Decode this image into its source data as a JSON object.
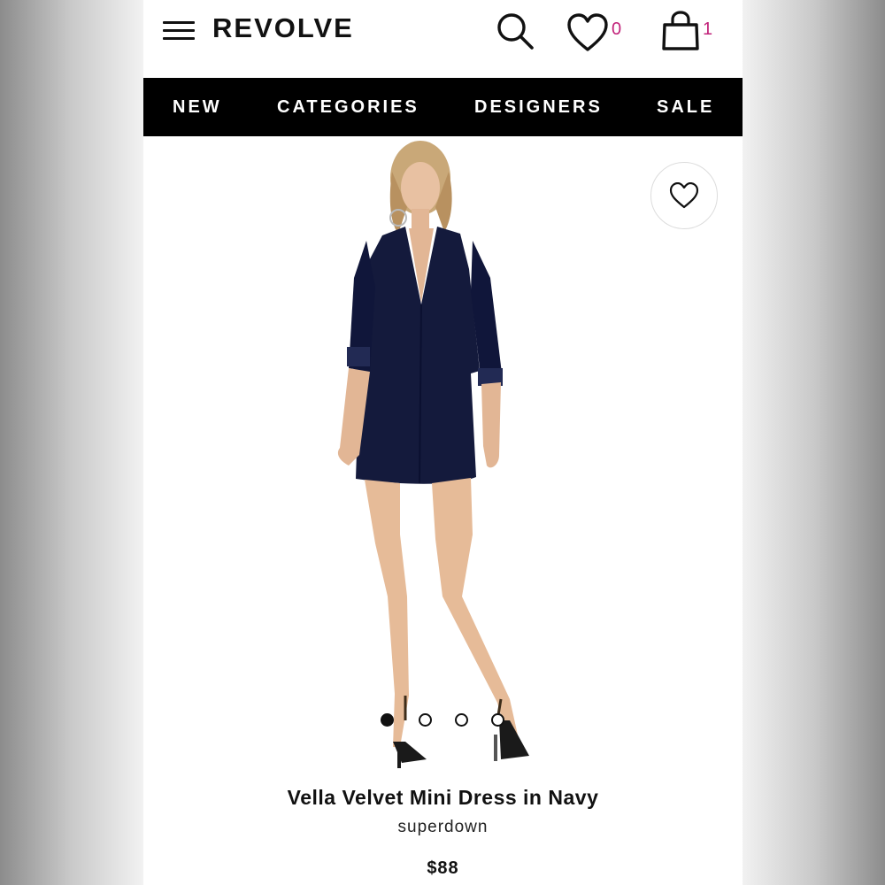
{
  "header": {
    "logo": "REVOLVE",
    "icons": [
      "menu-icon",
      "search-icon",
      "heart-icon",
      "shopping-bag-icon"
    ],
    "wishlist_count": "0",
    "bag_count": "1",
    "badge_color": "#c2237a"
  },
  "nav": {
    "items": [
      {
        "label": "NEW"
      },
      {
        "label": "CATEGORIES"
      },
      {
        "label": "DESIGNERS"
      },
      {
        "label": "SALE"
      }
    ]
  },
  "gallery": {
    "image_count": 4,
    "active_index": 1,
    "favorite_icon": "heart-icon"
  },
  "product": {
    "name": "Vella Velvet Mini Dress in Navy",
    "designer": "superdown",
    "price": "$88",
    "dress_color": "#141a3c"
  }
}
